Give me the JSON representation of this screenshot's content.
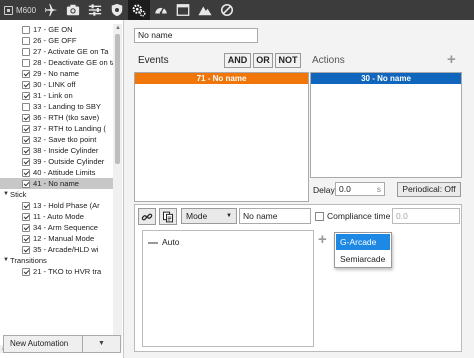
{
  "toolbar": {
    "device": "M600",
    "icons": [
      "airplane-icon",
      "camera-icon",
      "sliders-icon",
      "shield-gear-icon",
      "gear-icon",
      "gauge-icon",
      "window-icon",
      "mountain-icon",
      "prohibited-icon"
    ]
  },
  "sidebar": {
    "items": [
      {
        "label": "17 - GE ON",
        "checked": false,
        "type": "item"
      },
      {
        "label": "26 - GE OFF",
        "checked": false,
        "type": "item"
      },
      {
        "label": "27 - Activate GE on Ta",
        "checked": false,
        "type": "item"
      },
      {
        "label": "28 - Deactivate GE on ta",
        "checked": false,
        "type": "item"
      },
      {
        "label": "29 - No name",
        "checked": true,
        "type": "item"
      },
      {
        "label": "30 - LINK off",
        "checked": true,
        "type": "item"
      },
      {
        "label": "31 - Link on",
        "checked": true,
        "type": "item"
      },
      {
        "label": "33 - Landing to SBY",
        "checked": false,
        "type": "item"
      },
      {
        "label": "36 - RTH (tko save)",
        "checked": true,
        "type": "item"
      },
      {
        "label": "37 - RTH to Landing (",
        "checked": true,
        "type": "item"
      },
      {
        "label": "32 - Save tko point",
        "checked": true,
        "type": "item"
      },
      {
        "label": "38 - Inside Cylinder",
        "checked": true,
        "type": "item"
      },
      {
        "label": "39 - Outside Cylinder",
        "checked": true,
        "type": "item"
      },
      {
        "label": "40 - Attitude Limits",
        "checked": true,
        "type": "item"
      },
      {
        "label": "41 - No name",
        "checked": true,
        "type": "item",
        "selected": true
      },
      {
        "label": "Stick",
        "type": "group"
      },
      {
        "label": "13 - Hold Phase (Ar",
        "checked": true,
        "type": "item"
      },
      {
        "label": "11 - Auto Mode",
        "checked": true,
        "type": "item"
      },
      {
        "label": "34 - Arm Sequence",
        "checked": true,
        "type": "item"
      },
      {
        "label": "12 - Manual Mode",
        "checked": true,
        "type": "item"
      },
      {
        "label": "35 - Arcade/HLD wi",
        "checked": true,
        "type": "item"
      },
      {
        "label": "Transitions",
        "type": "group"
      },
      {
        "label": "21 - TKO to HVR tra",
        "checked": true,
        "type": "item"
      }
    ],
    "new_automation": "New Automation",
    "dropdown": "▼"
  },
  "main": {
    "name": "No name",
    "events_label": "Events",
    "and_label": "AND",
    "or_label": "OR",
    "not_label": "NOT",
    "actions_label": "Actions",
    "plus": "+",
    "event_item": "71 - No name",
    "action_item": "30 - No name",
    "delay_label": "Delay",
    "delay_value": "0.0",
    "delay_unit": "s",
    "periodical_label": "Periodical: Off"
  },
  "action_editor": {
    "mode_label": "Mode",
    "mode_caret": "▼",
    "name_value": "No name",
    "compliance_label": "Compliance time",
    "compliance_value": "0.0",
    "list_item": "Auto",
    "plus": "+",
    "options": [
      "G-Arcade",
      "Semiarcade"
    ]
  },
  "colors": {
    "event_bar": "#f0760a",
    "action_bar": "#1066bc",
    "selected_option": "#1e88e5"
  }
}
